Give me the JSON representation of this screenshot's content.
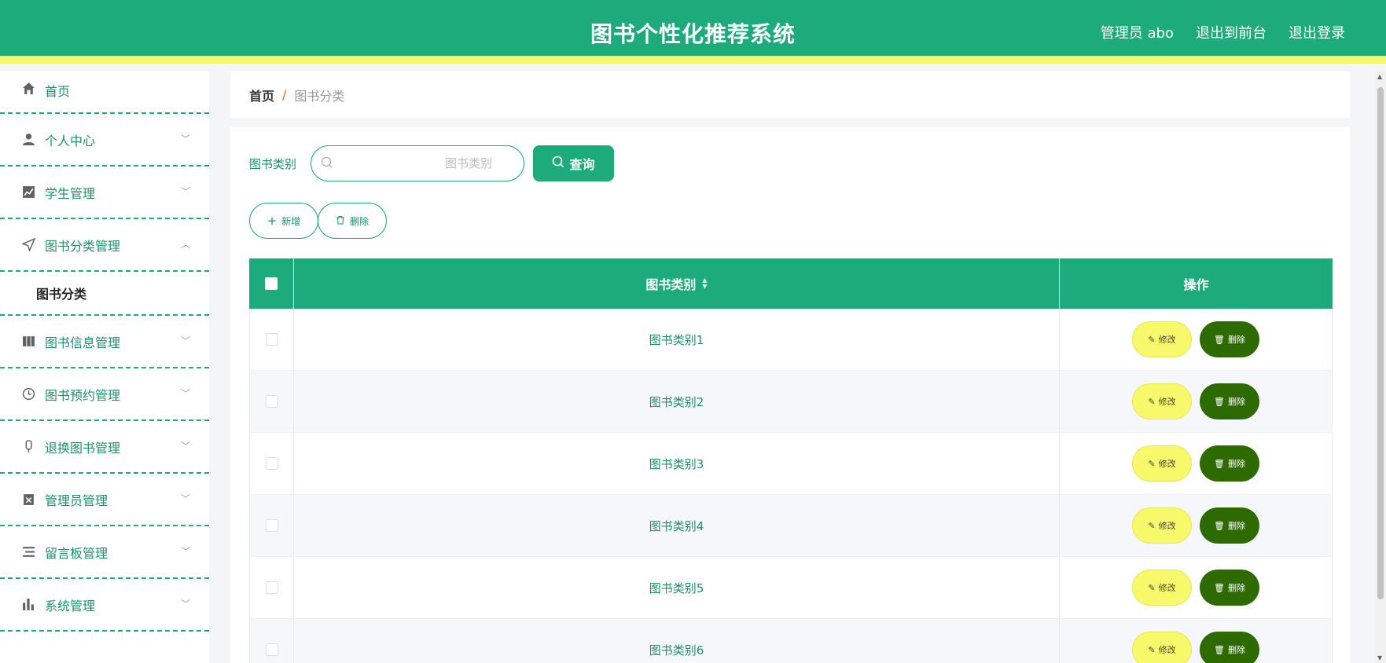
{
  "header": {
    "title": "图书个性化推荐系统",
    "user_label": "管理员 abo",
    "front_label": "退出到前台",
    "logout_label": "退出登录"
  },
  "sidebar": {
    "items": [
      {
        "label": "首页",
        "icon": "home-icon"
      },
      {
        "label": "个人中心",
        "icon": "user-icon"
      },
      {
        "label": "学生管理",
        "icon": "chart-icon"
      },
      {
        "label": "图书分类管理",
        "icon": "navigation-icon",
        "expanded": true,
        "submenu": [
          "图书分类"
        ]
      },
      {
        "label": "图书信息管理",
        "icon": "book-icon"
      },
      {
        "label": "图书预约管理",
        "icon": "clock-icon"
      },
      {
        "label": "退换图书管理",
        "icon": "microphone-icon"
      },
      {
        "label": "管理员管理",
        "icon": "clipboard-icon"
      },
      {
        "label": "留言板管理",
        "icon": "list-icon"
      },
      {
        "label": "系统管理",
        "icon": "bar-chart-icon"
      }
    ]
  },
  "breadcrumb": {
    "home": "首页",
    "separator": "/",
    "current": "图书分类"
  },
  "search": {
    "label": "图书类别",
    "placeholder": "图书类别",
    "value": "",
    "query_label": "查询"
  },
  "actions": {
    "add_label": "新增",
    "delete_label": "删除"
  },
  "table": {
    "columns": [
      "图书类别",
      "操作"
    ],
    "rows": [
      "图书类别1",
      "图书类别2",
      "图书类别3",
      "图书类别4",
      "图书类别5",
      "图书类别6"
    ],
    "edit_label": "修改",
    "delete_label": "删除"
  },
  "colors": {
    "primary": "#1dab7b",
    "accent": "#f7f96b",
    "danger": "#2d6a00"
  }
}
